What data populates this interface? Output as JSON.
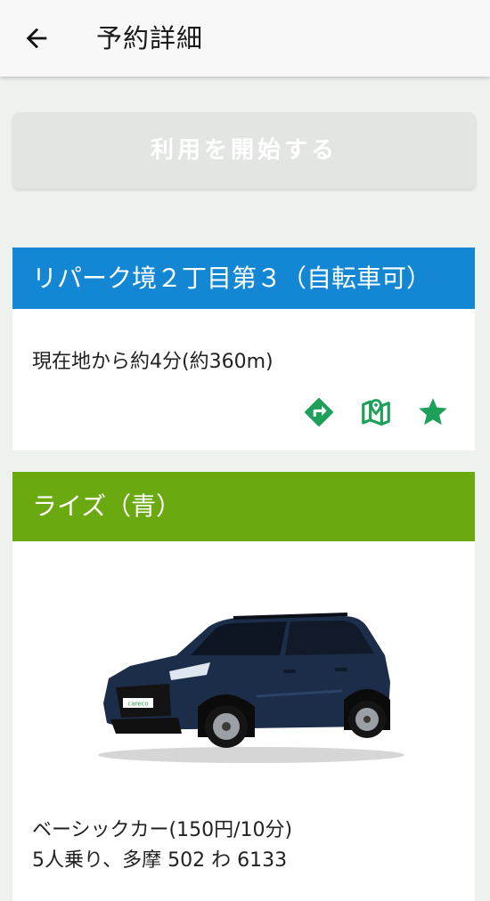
{
  "appbar": {
    "title": "予約詳細",
    "back_icon": "arrow-left-icon"
  },
  "start_button": {
    "label": "利用を開始する",
    "enabled": false
  },
  "station": {
    "name": "リパーク境２丁目第３（自転車可）",
    "distance": "現在地から約4分(約360m)",
    "header_color": "#1387d4",
    "actions": [
      {
        "icon": "directions-icon"
      },
      {
        "icon": "map-pin-icon"
      },
      {
        "icon": "star-icon"
      }
    ],
    "action_color": "#1fa05a"
  },
  "car": {
    "name": "ライズ（青）",
    "header_color": "#6aa90f",
    "class_price": "ベーシックカー(150円/10分)",
    "seats_plate": "5人乗り、多摩 502 わ 6133",
    "plate_text": "careco"
  }
}
